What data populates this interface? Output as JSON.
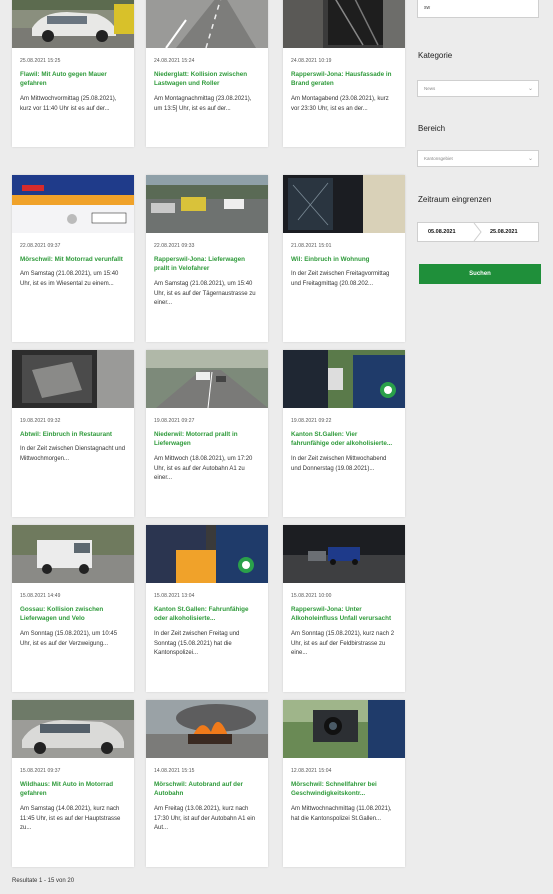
{
  "cards": [
    {
      "date": "25.08.2021 15:25",
      "title": "Flawil: Mit Auto gegen Mauer gefahren",
      "excerpt": "Am Mittwochvormittag (25.08.2021), kurz vor 11:40 Uhr ist es auf der...",
      "img": "crashed-white-car"
    },
    {
      "date": "24.08.2021 15:24",
      "title": "Niederglatt: Kollision zwischen Lastwagen und Roller",
      "excerpt": "Am Montagnachmittag (23.08.2021), um 13:5] Uhr, ist es auf der...",
      "img": "road-scene"
    },
    {
      "date": "24.08.2021 10:19",
      "title": "Rapperswil-Jona: Hausfassade in Brand geraten",
      "excerpt": "Am Montagabend (23.08.2021), kurz vor 23:30 Uhr, ist es an der...",
      "img": "burnt-facade"
    },
    {
      "date": "22.08.2021 09:37",
      "title": "Mörschwil: Mit Motorrad verunfallt",
      "excerpt": "Am Samstag (21.08.2021), um 15:40 Uhr, ist es im Wiesental zu einem...",
      "img": "police-car"
    },
    {
      "date": "22.08.2021 09:33",
      "title": "Rapperswil-Jona: Lieferwagen prallt in Velofahrer",
      "excerpt": "Am Samstag (21.08.2021), um 15:40 Uhr, ist es auf der Tägernaustrasse zu einer...",
      "img": "street-vehicles"
    },
    {
      "date": "21.08.2021 15:01",
      "title": "Wil: Einbruch in Wohnung",
      "excerpt": "In der Zeit zwischen Freitagvormittag und Freitagmittag (20.08.202...",
      "img": "broken-window"
    },
    {
      "date": "19.08.2021 09:32",
      "title": "Abtwil: Einbruch in Restaurant",
      "excerpt": "In der Zeit zwischen Dienstagnacht und Mittwochmorgen...",
      "img": "damaged-door"
    },
    {
      "date": "19.08.2021 09:27",
      "title": "Niederwil: Motorrad prallt in Lieferwagen",
      "excerpt": "Am Mittwoch (18.08.2021), um 17:20 Uhr, ist es auf der Autobahn A1 zu einer...",
      "img": "highway"
    },
    {
      "date": "19.08.2021 09:22",
      "title": "Kanton St.Gallen: Vier fahrunfähige oder alkoholisierte...",
      "excerpt": "In der Zeit zwischen Mittwochabend und Donnerstag (19.08.2021)...",
      "img": "police-officer"
    },
    {
      "date": "15.08.2021 14:49",
      "title": "Gossau: Kollision zwischen Lieferwagen und Velo",
      "excerpt": "Am Sonntag (15.08.2021), um 10:45 Uhr, ist es auf der Verzweigung...",
      "img": "white-van"
    },
    {
      "date": "15.08.2021 13:04",
      "title": "Kanton St.Gallen: Fahrunfähige oder alkoholisierte...",
      "excerpt": "In der Zeit zwischen Freitag und Sonntag (15.08.2021) hat die Kantonspolizei...",
      "img": "police-check"
    },
    {
      "date": "15.08.2021 10:00",
      "title": "Rapperswil-Jona: Unter Alkoholeinfluss Unfall verursacht",
      "excerpt": "Am Sonntag (15.08.2021), kurz nach 2 Uhr, ist es auf der Feldbirstrasse zu eine...",
      "img": "night-cars"
    },
    {
      "date": "15.08.2021 09:37",
      "title": "Wildhaus: Mit Auto in Motorrad gefahren",
      "excerpt": "Am Samstag (14.08.2021), kurz nach 11:45 Uhr, ist es auf der Hauptstrasse zu...",
      "img": "damaged-suv"
    },
    {
      "date": "14.08.2021 15:15",
      "title": "Mörschwil: Autobrand auf der Autobahn",
      "excerpt": "Am Freitag (13.08.2021), kurz nach 17:30 Uhr, ist auf der Autobahn A1 ein Aut...",
      "img": "car-fire"
    },
    {
      "date": "12.08.2021 15:04",
      "title": "Mörschwil: Schnellfahrer bei Geschwindigkeitskontr...",
      "excerpt": "Am Mittwochnachmittag (11.08.2021), hat die Kantonspolizei St.Gallen...",
      "img": "speed-camera"
    }
  ],
  "sidebar": {
    "top_value": "sw",
    "kategorie_label": "Kategorie",
    "kategorie_value": "News",
    "bereich_label": "Bereich",
    "bereich_value": "Kantonsgebiet",
    "zeitraum_label": "Zeitraum eingrenzen",
    "date_from": "05.08.2021",
    "date_to": "25.08.2021",
    "search_label": "Suchen"
  },
  "results_text": "Resultate 1 - 15 von 20",
  "colors": {
    "accent": "#1f8f3a",
    "title_green": "#2e9a3a"
  }
}
